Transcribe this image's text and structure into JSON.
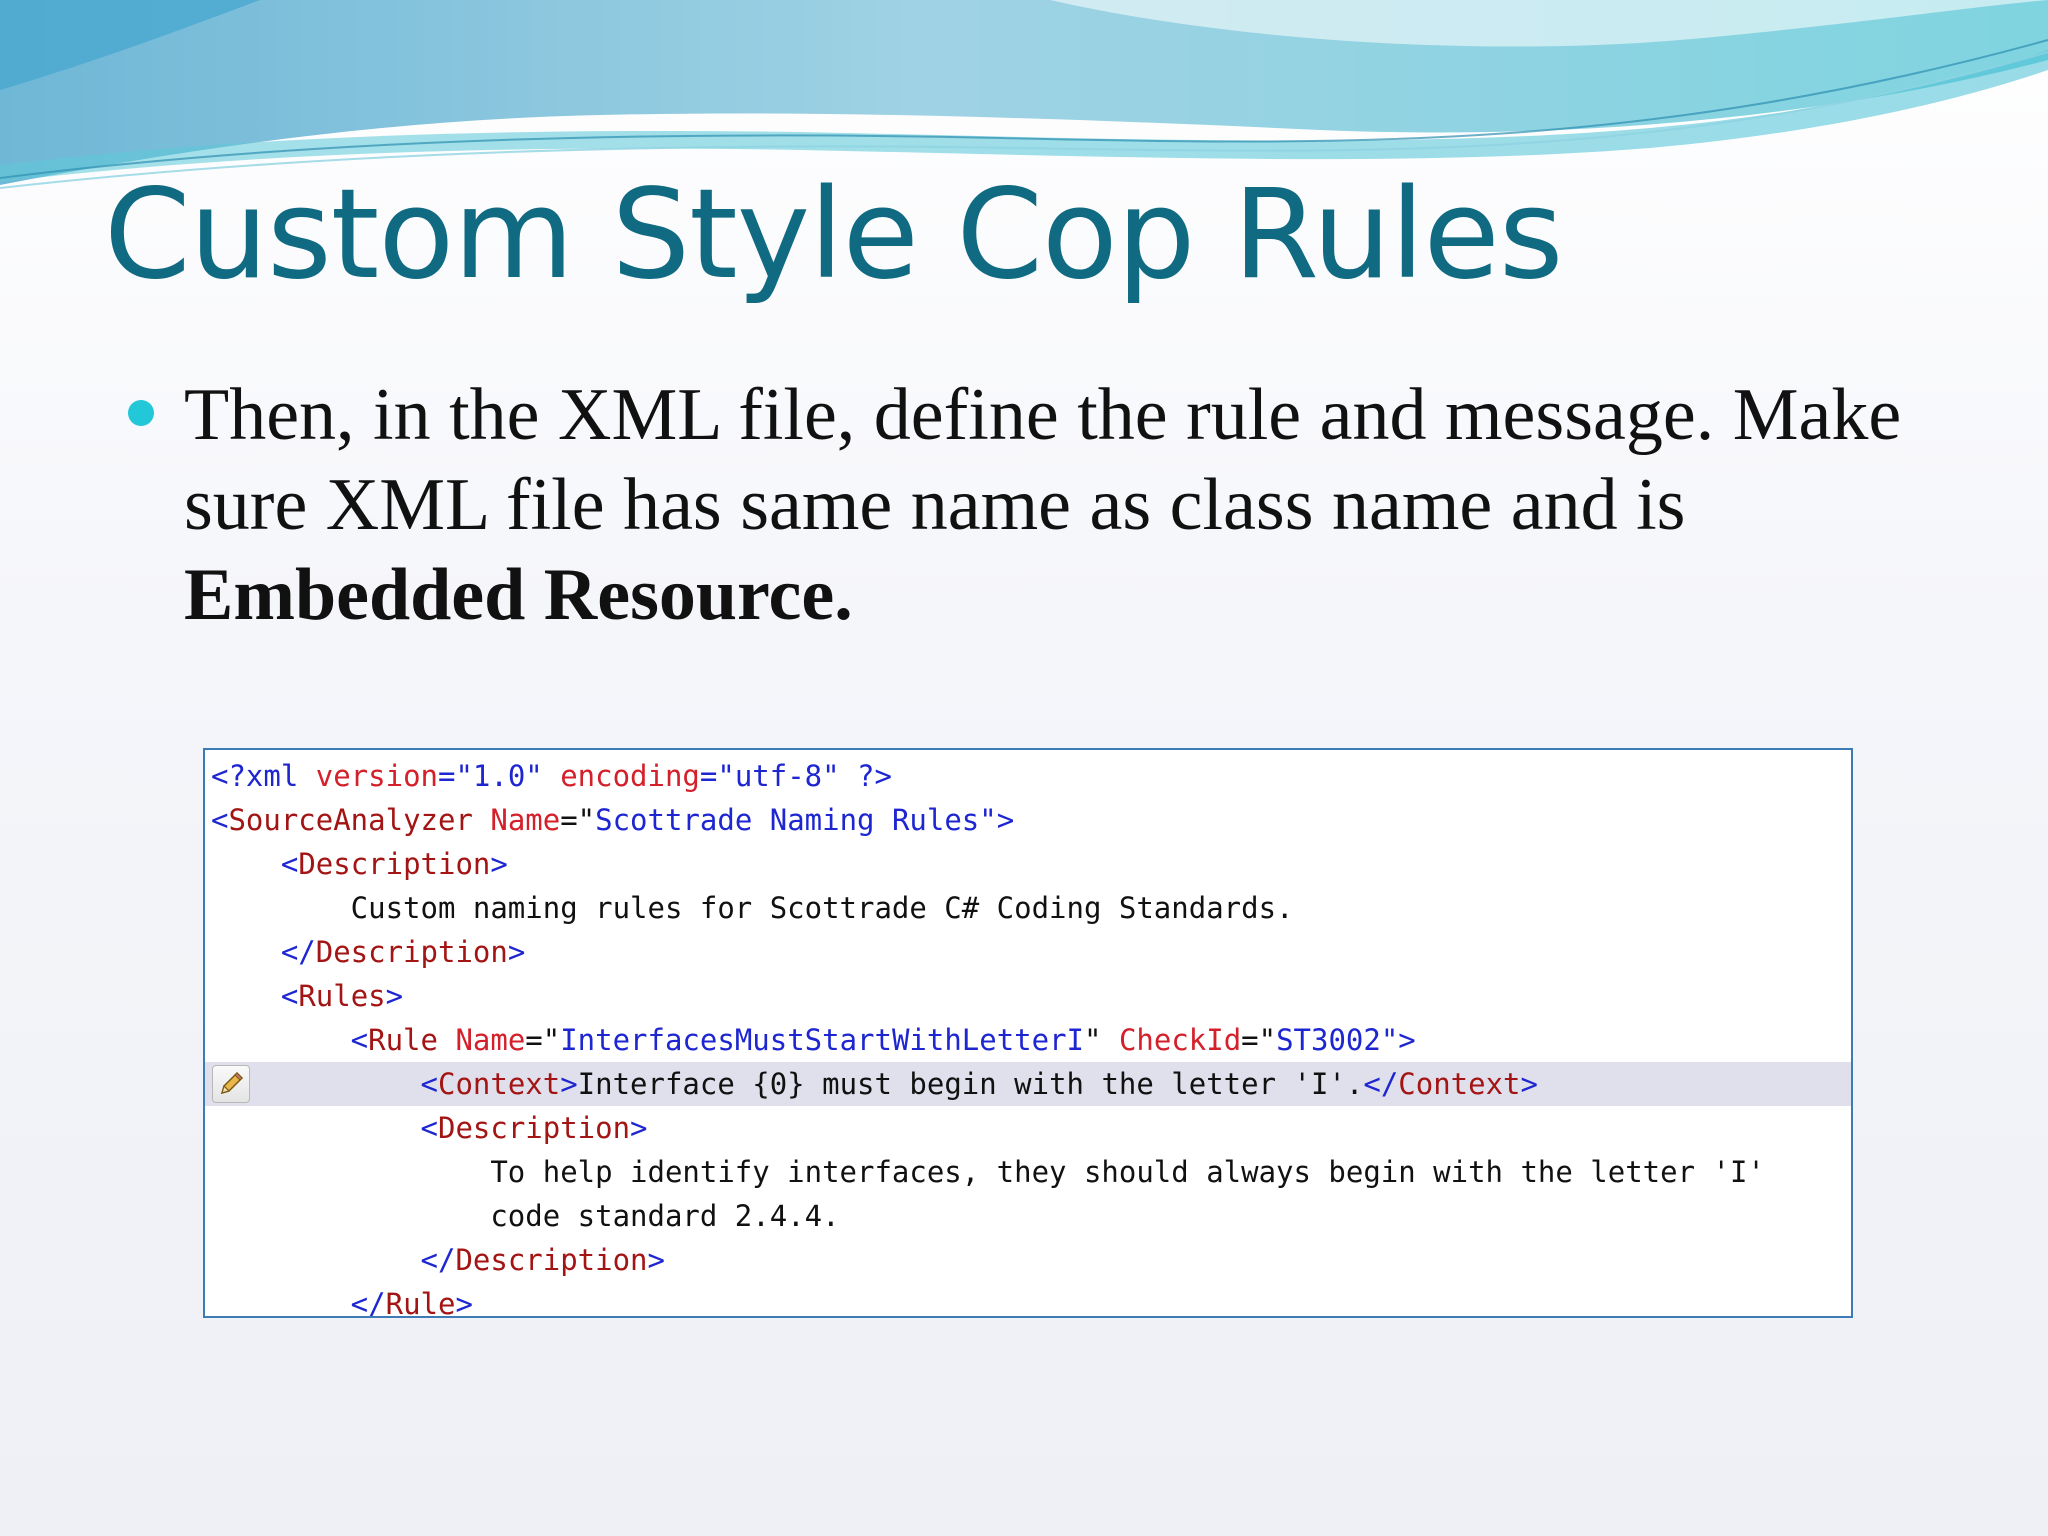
{
  "slide": {
    "title": "Custom Style Cop Rules",
    "bullet": {
      "text_before": "Then, in the XML file, define the rule and message. Make sure XML file has same name as class name and is ",
      "bold_text": "Embedded Resource."
    }
  },
  "code": {
    "lines": [
      {
        "tokens": [
          [
            "<?xml ",
            "blue"
          ],
          [
            "version",
            "red"
          ],
          [
            "=\"",
            "blue"
          ],
          [
            "1.0",
            "blue"
          ],
          [
            "\" ",
            "blue"
          ],
          [
            "encoding",
            "red"
          ],
          [
            "=\"",
            "blue"
          ],
          [
            "utf-8",
            "blue"
          ],
          [
            "\" ?>",
            "blue"
          ]
        ]
      },
      {
        "tokens": [
          [
            "<",
            "blue"
          ],
          [
            "SourceAnalyzer",
            "brown"
          ],
          [
            " Name",
            "red"
          ],
          [
            "=\"",
            "black"
          ],
          [
            "Scottrade Naming Rules",
            "blue"
          ],
          [
            "\">",
            "blue"
          ]
        ]
      },
      {
        "tokens": [
          [
            "    <",
            "blue"
          ],
          [
            "Description",
            "brown"
          ],
          [
            ">",
            "blue"
          ]
        ]
      },
      {
        "tokens": [
          [
            "        Custom naming rules for Scottrade C# Coding Standards.",
            "black"
          ]
        ]
      },
      {
        "tokens": [
          [
            "    </",
            "blue"
          ],
          [
            "Description",
            "brown"
          ],
          [
            ">",
            "blue"
          ]
        ]
      },
      {
        "tokens": [
          [
            "    <",
            "blue"
          ],
          [
            "Rules",
            "brown"
          ],
          [
            ">",
            "blue"
          ]
        ]
      },
      {
        "tokens": [
          [
            "        <",
            "blue"
          ],
          [
            "Rule",
            "brown"
          ],
          [
            " Name",
            "red"
          ],
          [
            "=\"",
            "black"
          ],
          [
            "InterfacesMustStartWithLetterI",
            "blue"
          ],
          [
            "\" ",
            "black"
          ],
          [
            "CheckId",
            "red"
          ],
          [
            "=\"",
            "black"
          ],
          [
            "ST3002",
            "blue"
          ],
          [
            "\">",
            "blue"
          ]
        ]
      },
      {
        "highlight": true,
        "tokens": [
          [
            "            <",
            "blue"
          ],
          [
            "Context",
            "brown"
          ],
          [
            ">",
            "blue"
          ],
          [
            "Interface {0} must begin with the letter 'I'.",
            "black"
          ],
          [
            "</",
            "blue"
          ],
          [
            "Context",
            "brown"
          ],
          [
            ">",
            "blue"
          ]
        ]
      },
      {
        "tokens": [
          [
            "            <",
            "blue"
          ],
          [
            "Description",
            "brown"
          ],
          [
            ">",
            "blue"
          ]
        ]
      },
      {
        "tokens": [
          [
            "                To help identify interfaces, they should always begin with the letter 'I'",
            "black"
          ]
        ]
      },
      {
        "tokens": [
          [
            "                code standard 2.4.4.",
            "black"
          ]
        ]
      },
      {
        "tokens": [
          [
            "            </",
            "blue"
          ],
          [
            "Description",
            "brown"
          ],
          [
            ">",
            "blue"
          ]
        ]
      },
      {
        "tokens": [
          [
            "        </",
            "blue"
          ],
          [
            "Rule",
            "brown"
          ],
          [
            ">",
            "blue"
          ]
        ]
      }
    ]
  },
  "icons": {
    "gutter": "pencil-edit-icon"
  },
  "colors": {
    "title": "#0f6a82",
    "bullet": "#22c7d8",
    "xml_tag_delimiter": "#1d26d0",
    "xml_element_name": "#a31515",
    "xml_attribute_name": "#d4202a",
    "xml_attribute_value": "#1d26d0",
    "panel_border": "#3c7bb6",
    "highlight_line": "#e0e0ec"
  }
}
